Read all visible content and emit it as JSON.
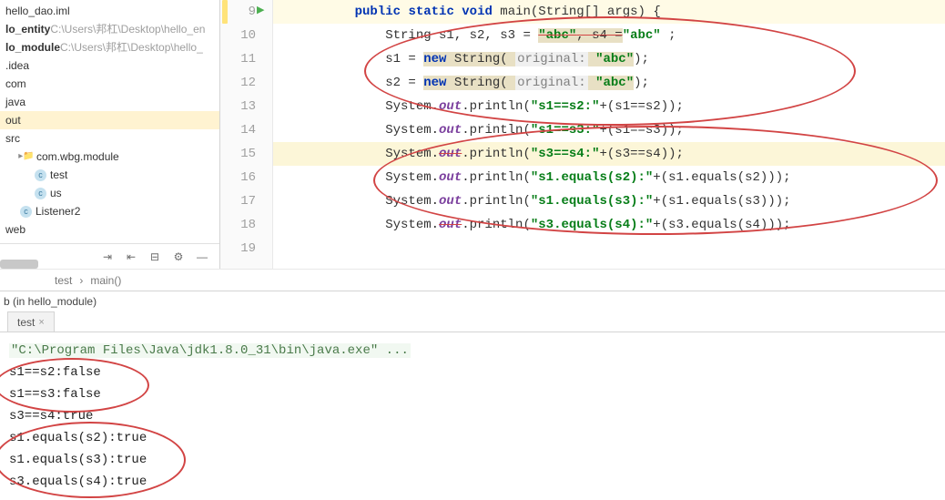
{
  "sidebar": {
    "items": [
      {
        "label": "hello_dao.iml",
        "path": "",
        "bold": false,
        "lv": 1,
        "icon": ""
      },
      {
        "label": "lo_entity",
        "path": " C:\\Users\\邦杠\\Desktop\\hello_en",
        "bold": true,
        "lv": 1,
        "icon": ""
      },
      {
        "label": "lo_module",
        "path": " C:\\Users\\邦杠\\Desktop\\hello_",
        "bold": true,
        "lv": 1,
        "icon": ""
      },
      {
        "label": ".idea",
        "path": "",
        "bold": false,
        "lv": 1,
        "icon": ""
      },
      {
        "label": "com",
        "path": "",
        "bold": false,
        "lv": 1,
        "icon": ""
      },
      {
        "label": "java",
        "path": "",
        "bold": false,
        "lv": 1,
        "icon": ""
      },
      {
        "label": "out",
        "path": "",
        "bold": false,
        "lv": 1,
        "icon": "",
        "sel": true
      },
      {
        "label": "src",
        "path": "",
        "bold": false,
        "lv": 1,
        "icon": ""
      },
      {
        "label": "com.wbg.module",
        "path": "",
        "bold": false,
        "lv": 2,
        "icon": "folder"
      },
      {
        "label": "test",
        "path": "",
        "bold": false,
        "lv": 3,
        "icon": "class"
      },
      {
        "label": "us",
        "path": "",
        "bold": false,
        "lv": 3,
        "icon": "class"
      },
      {
        "label": "Listener2",
        "path": "",
        "bold": false,
        "lv": 2,
        "icon": "class"
      },
      {
        "label": "web",
        "path": "",
        "bold": false,
        "lv": 1,
        "icon": ""
      }
    ]
  },
  "code": {
    "lines": [
      9,
      10,
      11,
      12,
      13,
      14,
      15,
      16,
      17,
      18,
      19
    ],
    "l9a": "public",
    "l9b": "static",
    "l9c": "void",
    "l9d": " main(String[] args) {",
    "l10a": "String s1, s2, s3 = ",
    "l10b": "\"abc\"",
    "l10c": ", s4 =",
    "l10d": "\"abc\"",
    "l10e": " ;",
    "l11a": "s1 = ",
    "l11b": "new",
    "l11c": " String( ",
    "l11p": "original:",
    "l11d": " \"abc\"",
    "l11e": ");",
    "l12a": "s2 = ",
    "l12b": "new",
    "l12c": " String( ",
    "l12p": "original:",
    "l12d": " \"abc\"",
    "l12e": ");",
    "l13a": "System.",
    "l13b": "out",
    "l13c": ".println(",
    "l13d": "\"s1==s2:\"",
    "l13e": "+(s1==s2));",
    "l14a": "System.",
    "l14b": "out",
    "l14c": ".println(",
    "l14d": "\"s1==s3:\"",
    "l14e": "+(s1==s3));",
    "l15a": "System.",
    "l15b": "out",
    "l15c": ".println(",
    "l15d": "\"s3==s4:\"",
    "l15e": "+(s3==s4));",
    "l16a": "System.",
    "l16b": "out",
    "l16c": ".println(",
    "l16d": "\"s1.equals(s2):\"",
    "l16e": "+(s1.equals(s2)));",
    "l17a": "System.",
    "l17b": "out",
    "l17c": ".println(",
    "l17d": "\"s1.equals(s3):\"",
    "l17e": "+(s1.equals(s3)));",
    "l18a": "System.",
    "l18b": "out",
    "l18c": ".println(",
    "l18d": "\"s3.equals(s4):\"",
    "l18e": "+(s3.equals(s4)));"
  },
  "breadcrumb": {
    "a": "test",
    "b": "main()",
    "sep": "›"
  },
  "structure": "b (in hello_module)",
  "runtab": "test",
  "console": {
    "cmd": "\"C:\\Program Files\\Java\\jdk1.8.0_31\\bin\\java.exe\" ...",
    "o1": "s1==s2:false",
    "o2": "s1==s3:false",
    "o3": "s3==s4:true",
    "o4": "s1.equals(s2):true",
    "o5": "s1.equals(s3):true",
    "o6": "s3.equals(s4):true"
  }
}
